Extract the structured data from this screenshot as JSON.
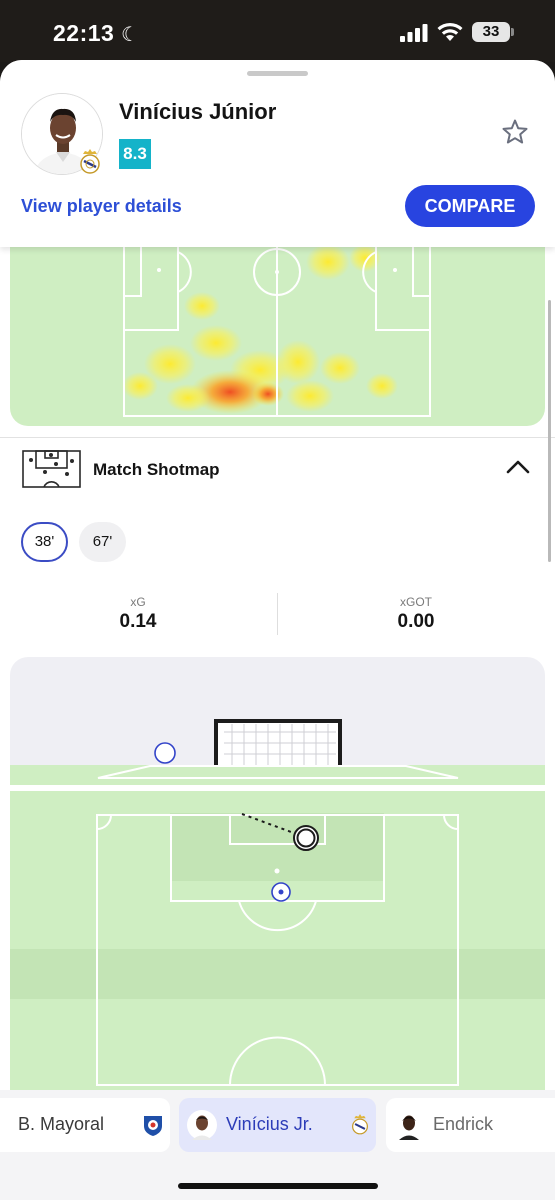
{
  "status_bar": {
    "time": "22:13",
    "battery": "33",
    "icons": [
      "moon-icon",
      "signal-icon",
      "wifi-icon",
      "battery-icon"
    ]
  },
  "player": {
    "name": "Vinícius Júnior",
    "rating": "8.3",
    "rating_color": "#14b3c9",
    "view_details_label": "View player details",
    "compare_label": "COMPARE",
    "accent_color": "#2844e0"
  },
  "shotmap": {
    "title": "Match Shotmap",
    "chips": [
      {
        "label": "38'",
        "selected": true
      },
      {
        "label": "67'",
        "selected": false
      }
    ],
    "stats": [
      {
        "label": "xG",
        "value": "0.14"
      },
      {
        "label": "xGOT",
        "value": "0.00"
      }
    ]
  },
  "player_bar": {
    "items": [
      {
        "name": "B. Mayoral",
        "selected": false
      },
      {
        "name": "Vinícius Jr.",
        "selected": true
      },
      {
        "name": "Endrick",
        "selected": false
      }
    ]
  }
}
